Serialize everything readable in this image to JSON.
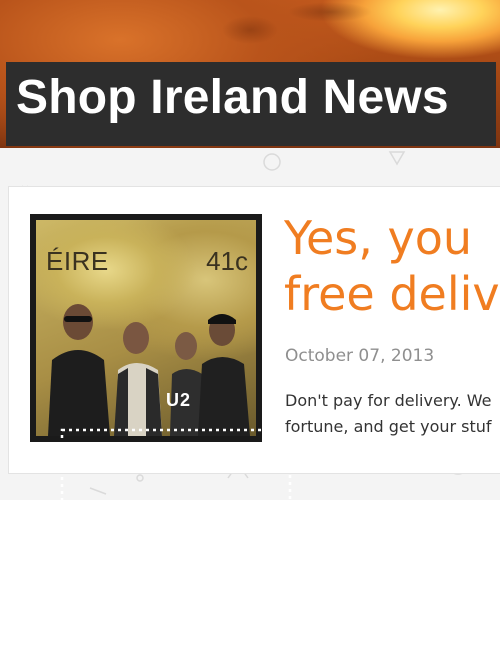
{
  "site": {
    "title": "Shop Ireland News"
  },
  "post": {
    "title_line1": "Yes, you",
    "title_line2": "free deliv",
    "date": "October 07, 2013",
    "excerpt_line1": "Don't pay for delivery. We",
    "excerpt_line2": "fortune, and get your stuf"
  },
  "stamp": {
    "country": "ÉIRE",
    "value": "41c",
    "logo": "U2"
  },
  "colors": {
    "title_bar": "#2d2d2d",
    "accent": "#f07d21",
    "date": "#8f8f8f",
    "text": "#333333"
  }
}
